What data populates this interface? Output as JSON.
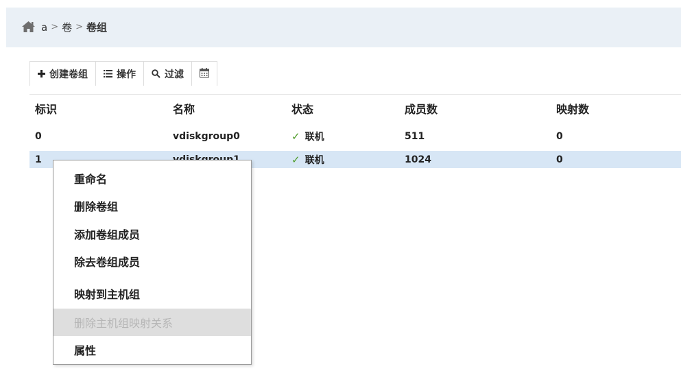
{
  "breadcrumb": {
    "items": [
      "a",
      "卷",
      "卷组"
    ],
    "separator": ">"
  },
  "toolbar": {
    "create_label": "创建卷组",
    "operate_label": "操作",
    "filter_label": "过滤"
  },
  "table": {
    "columns": [
      "标识",
      "名称",
      "状态",
      "成员数",
      "映射数"
    ],
    "rows": [
      {
        "id": "0",
        "name": "vdiskgroup0",
        "status": "联机",
        "members": "511",
        "mappings": "0"
      },
      {
        "id": "1",
        "name": "vdiskgroup1",
        "status": "联机",
        "members": "1024",
        "mappings": "0"
      }
    ],
    "selected_row": 1
  },
  "context_menu": {
    "items": [
      {
        "label": "重命名",
        "enabled": true
      },
      {
        "label": "删除卷组",
        "enabled": true
      },
      {
        "label": "添加卷组成员",
        "enabled": true
      },
      {
        "label": "除去卷组成员",
        "enabled": true
      },
      {
        "label": "映射到主机组",
        "enabled": true
      },
      {
        "label": "删除主机组映射关系",
        "enabled": false
      },
      {
        "label": "属性",
        "enabled": true
      }
    ]
  },
  "colors": {
    "accent": "#d7e6f5",
    "online": "#4c9b27",
    "breadcrumb_bg": "#eaf0f6"
  }
}
